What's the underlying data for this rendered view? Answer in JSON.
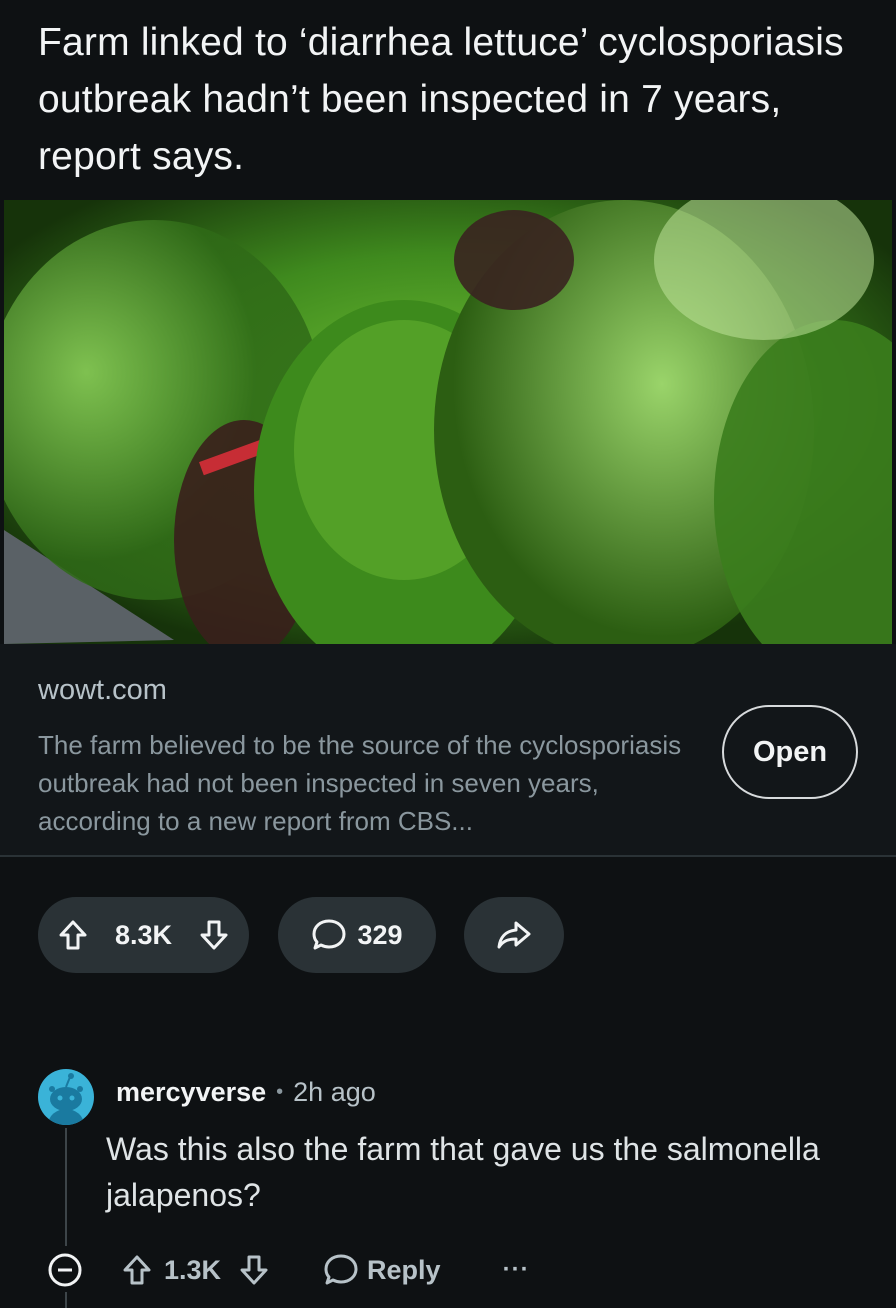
{
  "post": {
    "title": "Farm linked to ‘diarrhea lettuce’ cyclosporiasis outbreak hadn’t been inspected in 7 years, report says."
  },
  "link_card": {
    "domain": "wowt.com",
    "description": "The farm believed to be the source of the cyclosporiasis outbreak had not been inspected in seven years, according to a new report from CBS...",
    "open_label": "Open",
    "thumbnail_icon": "lettuce-photo"
  },
  "actions": {
    "vote_count": "8.3K",
    "comment_count": "329"
  },
  "comment": {
    "username": "mercyverse",
    "separator": "•",
    "time": "2h ago",
    "body": "Was this also the farm that gave us the salmonella jalapenos?",
    "vote_count": "1.3K",
    "reply_label": "Reply",
    "more_label": "···"
  },
  "colors": {
    "background": "#0e1113",
    "pill": "#2a3236",
    "avatar": "#3ab3d8"
  }
}
